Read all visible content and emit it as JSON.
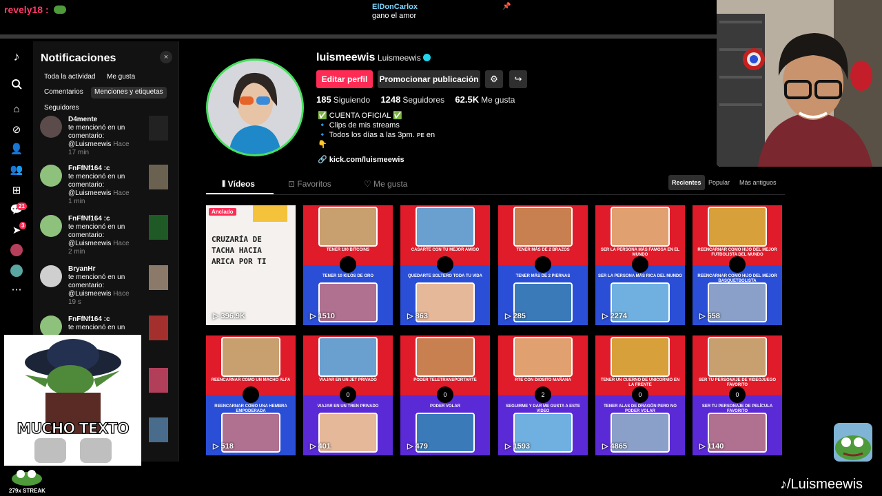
{
  "stream": {
    "top_user": "revely18 :",
    "chat_name": "ElDonCarlox",
    "chat_message": "gano el amor",
    "watermark": "/Luismeewis",
    "meme_text": "MUCHO TEXTO",
    "streak": "279x STREAK"
  },
  "rail": {
    "badges": {
      "activity": "21",
      "messages": "3"
    }
  },
  "notifications": {
    "title": "Notificaciones",
    "close": "×",
    "filters": [
      "Toda la actividad",
      "Me gusta",
      "Comentarios",
      "Menciones y etiquetas",
      "Seguidores"
    ],
    "active_filter": "Menciones y etiquetas",
    "items": [
      {
        "name": "D4mente",
        "line1": "te mencionó en un",
        "line2": "comentario:",
        "handle": "@Luismeewis",
        "hace": "Hace",
        "time": "17 min"
      },
      {
        "name": "FnFfNf164 :c",
        "line1": "te mencionó en un",
        "line2": "comentario:",
        "handle": "@Luismeewis",
        "hace": "Hace",
        "time": "1 min"
      },
      {
        "name": "FnFfNf164 :c",
        "line1": "te mencionó en un",
        "line2": "comentario:",
        "handle": "@Luismeewis",
        "hace": "Hace",
        "time": "2 min"
      },
      {
        "name": "BryanHr",
        "line1": "te mencionó en un",
        "line2": "comentario:",
        "handle": "@Luismeewis",
        "hace": "Hace",
        "time": "19 s"
      },
      {
        "name": "FnFfNf164 :c",
        "line1": "te mencionó en un",
        "line2": "",
        "handle": "",
        "hace": "",
        "time": ""
      }
    ]
  },
  "profile": {
    "username": "luismeewis",
    "display_name": "Luismeewis",
    "edit_button": "Editar perfil",
    "promote_button": "Promocionar publicación",
    "following_count": "185",
    "following_label": "Siguiendo",
    "followers_count": "1248",
    "followers_label": "Seguidores",
    "likes_count": "62.5K",
    "likes_label": "Me gusta",
    "bio": [
      "✅ CUENTA OFICIAL ✅",
      "🔹 Clips de mis streams",
      "🔹 Todos los días a las 3pm. ᴘᴇ en",
      "👇"
    ],
    "link": "kick.com/luismeewis"
  },
  "tabs": {
    "videos": "Vídeos",
    "favorites": "Favoritos",
    "liked": "Me gusta"
  },
  "sort": {
    "recent": "Recientes",
    "popular": "Popular",
    "oldest": "Más antiguos"
  },
  "videos": [
    {
      "pinned": "Anclado",
      "text": "CRUZARÍA DE TACHA HACIA ARICA POR TI",
      "views": "396.9K"
    },
    {
      "top": "TENER 100 BITCOINS",
      "bottom": "TENER 10 KILOS DE ORO",
      "views": "1510"
    },
    {
      "top": "CASARTE CON TU MEJOR AMIGO",
      "bottom": "QUEDARTE SOLTERO TODA TU VIDA",
      "views": "863"
    },
    {
      "top": "TENER MÁS DE 2 BRAZOS",
      "bottom": "TENER MÁS DE 2 PIERNAS",
      "views": "285"
    },
    {
      "top": "SER LA PERSONA MÁS FAMOSA EN EL MUNDO",
      "bottom": "SER LA PERSONA MÁS RICA DEL MUNDO",
      "views": "2274"
    },
    {
      "top": "REENCARNAR COMO HIJO DEL MEJOR FUTBOLISTA DEL MUNDO",
      "bottom": "REENCARNAR COMO HIJO DEL MEJOR BASQUETBOLISTA",
      "views": "658"
    },
    {
      "top": "REENCARNAR COMO UN MACHO ALFA",
      "bottom": "REENCARNAR COMO UNA HEMBRA EMPODERADA",
      "views": "518"
    },
    {
      "top": "VIAJAR EN UN JET PRIVADO",
      "bottom": "VIAJAR EN UN TREN PRIVADO",
      "views": "401",
      "dot": "0"
    },
    {
      "top": "PODER TELETRANSPORTARTE",
      "bottom": "PODER VOLAR",
      "views": "479",
      "dot": "0"
    },
    {
      "top": "RTE CON DIOSITO MAÑANA",
      "bottom": "SEGUIRME Y DAR ME GUSTA A ESTE VIDEO",
      "views": "1593",
      "dot": "2"
    },
    {
      "top": "TENER UN CUERNO DE UNICORNIO EN LA FRENTE",
      "bottom": "TENER ALAS DE DRAGÓN PERO NO PODER VOLAR",
      "views": "4865",
      "dot": "0"
    },
    {
      "top": "SER TU PERSONAJE DE VIDEOJUEGO FAVORITO",
      "bottom": "SER TU PERSONAJE DE PELÍCULA FAVORITO",
      "views": "1140",
      "dot": "0"
    }
  ],
  "colors": {
    "accent": "#fe2c55",
    "ring": "#46e05c",
    "red_half": "#e01b2a",
    "blue_half": "#2a4fd6",
    "purple_half": "#5a2ad6"
  }
}
